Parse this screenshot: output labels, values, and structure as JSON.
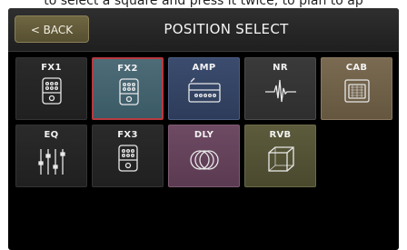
{
  "caption": "to select a square and press it twice, to plan to ap",
  "header": {
    "back_label": "< BACK",
    "title": "POSITION SELECT"
  },
  "tiles": [
    {
      "label": "FX1",
      "icon": "pedal-icon"
    },
    {
      "label": "FX2",
      "icon": "pedal-icon",
      "selected": true
    },
    {
      "label": "AMP",
      "icon": "amp-icon"
    },
    {
      "label": "NR",
      "icon": "waveform-icon"
    },
    {
      "label": "CAB",
      "icon": "cabinet-icon"
    },
    {
      "label": "EQ",
      "icon": "eq-sliders-icon"
    },
    {
      "label": "FX3",
      "icon": "pedal-icon"
    },
    {
      "label": "DLY",
      "icon": "delay-rings-icon"
    },
    {
      "label": "RVB",
      "icon": "reverb-cube-icon"
    }
  ],
  "colors": {
    "selected_border": "#b73a3f",
    "back_button": "#6f6642",
    "amp_tile": "#3b4c6e",
    "cab_tile": "#7a6a52",
    "dly_tile": "#6e4a63",
    "rvb_tile": "#5c5b3c",
    "fx2_tile": "#4d6c78"
  }
}
